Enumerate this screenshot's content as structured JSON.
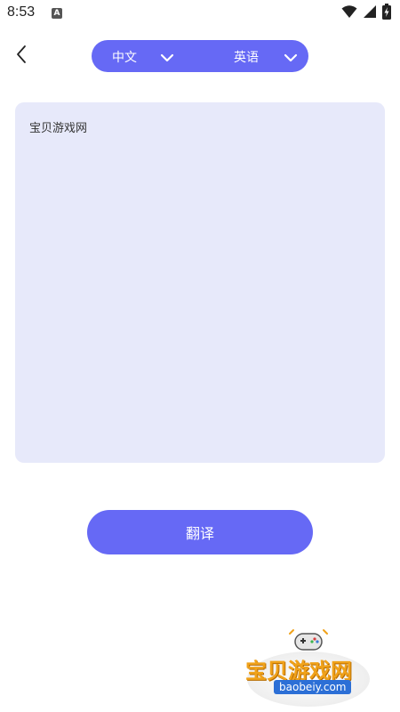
{
  "status_bar": {
    "time": "8:53",
    "notification_icon_letter": "A",
    "icons": [
      "wifi-icon",
      "cellular-signal-icon",
      "battery-charging-icon"
    ]
  },
  "header": {
    "back_icon": "chevron-left-icon",
    "source_language": "中文",
    "target_language": "英语",
    "dropdown_icon": "chevron-down-icon",
    "accent_color": "#6669f5"
  },
  "input": {
    "text": "宝贝游戏网",
    "background_color": "#e7e9fa"
  },
  "translate_button": {
    "label": "翻译"
  },
  "watermark": {
    "title": "宝贝游戏网",
    "url": "baobeiy.com",
    "icon": "gamepad-icon"
  }
}
